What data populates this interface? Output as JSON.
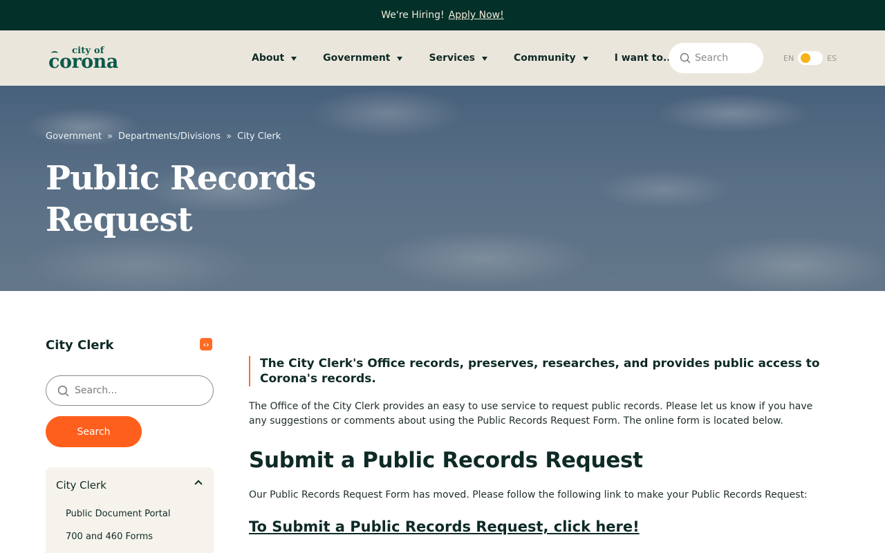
{
  "topbar": {
    "text": "We're Hiring!",
    "link": "Apply Now!"
  },
  "logo": {
    "small": "city of",
    "big": "corona"
  },
  "nav": [
    {
      "label": "About"
    },
    {
      "label": "Government"
    },
    {
      "label": "Services"
    },
    {
      "label": "Community"
    },
    {
      "label": "I want to.."
    }
  ],
  "header_search": {
    "placeholder": "Search"
  },
  "lang": {
    "left": "EN",
    "right": "ES"
  },
  "breadcrumb": [
    "Government",
    "Departments/Divisions",
    "City Clerk"
  ],
  "breadcrumb_sep": "»",
  "hero": {
    "title": "Public Records Request"
  },
  "sidebar": {
    "title": "City Clerk",
    "search_placeholder": "Search...",
    "search_button": "Search",
    "menu_head": "City Clerk",
    "items": [
      "Public Document Portal",
      "700 and 460 Forms"
    ]
  },
  "main": {
    "callout": "The City Clerk's Office records, preserves, researches, and provides public access to Corona's records.",
    "intro": "The Office of the City Clerk provides an easy to use service to request public records. Please let us know if you have any suggestions or comments about using the Public Records Request Form. The online form is located below.",
    "section_title": "Submit a Public Records Request",
    "section_text": "Our Public Records Request Form has moved. Please follow the following link to make your Public Records Request:",
    "submit_link": "To Submit a Public Records Request, click here!"
  },
  "colors": {
    "dark_green": "#033029",
    "accent_orange": "#ff5f1c",
    "beige": "#ebe6dc",
    "toggle_knob": "#f6b41a"
  },
  "icons": [
    "search-icon",
    "caret-down-icon",
    "chevron-up-icon",
    "collapse-icon"
  ]
}
